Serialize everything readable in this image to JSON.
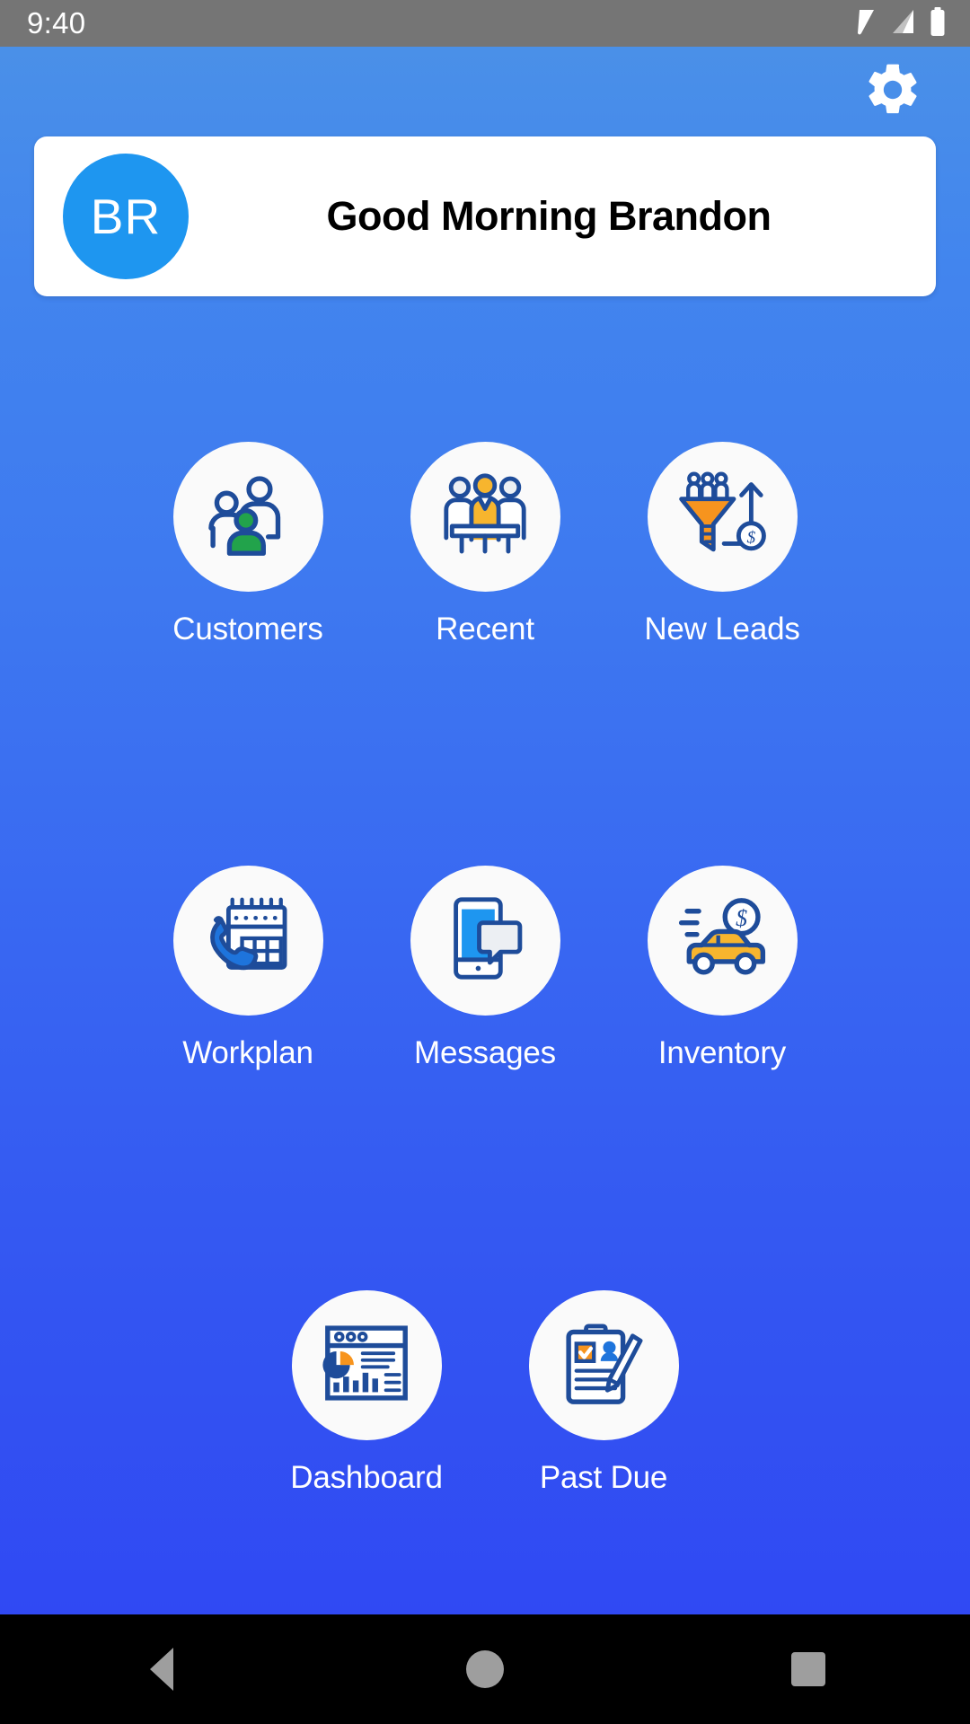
{
  "status_bar": {
    "time": "9:40",
    "icons": [
      "wifi-icon",
      "signal-icon",
      "battery-icon"
    ]
  },
  "header": {
    "settings_icon": "gear-icon",
    "avatar_initials": "BR",
    "greeting": "Good Morning Brandon",
    "avatar_color": "#1E96F0",
    "card_background": "#FFFFFF"
  },
  "theme": {
    "bg_top": "#4A90E8",
    "bg_bottom": "#3049F3",
    "tile_bg": "#FAFAFA",
    "icon_navy": "#1E4C9A",
    "icon_orange": "#F7941E",
    "icon_green": "#22A34B",
    "icon_blue": "#1E96F0",
    "label_color": "#FFFFFF",
    "statusbar_bg": "#757575",
    "navbar_bg": "#000000"
  },
  "grid": {
    "rows": [
      [
        {
          "label": "Customers",
          "icon": "customers-group-icon"
        },
        {
          "label": "Recent",
          "icon": "meeting-people-icon"
        },
        {
          "label": "New Leads",
          "icon": "sales-funnel-dollar-icon"
        }
      ],
      [
        {
          "label": "Workplan",
          "icon": "phone-calendar-icon"
        },
        {
          "label": "Messages",
          "icon": "mobile-chat-icon"
        },
        {
          "label": "Inventory",
          "icon": "car-dollar-icon"
        }
      ],
      [
        {
          "label": "Dashboard",
          "icon": "analytics-window-icon"
        },
        {
          "label": "Past Due",
          "icon": "clipboard-checklist-icon"
        }
      ]
    ]
  },
  "navigation_bar": {
    "back": "back-triangle-icon",
    "home": "home-circle-icon",
    "recents": "recents-square-icon"
  }
}
